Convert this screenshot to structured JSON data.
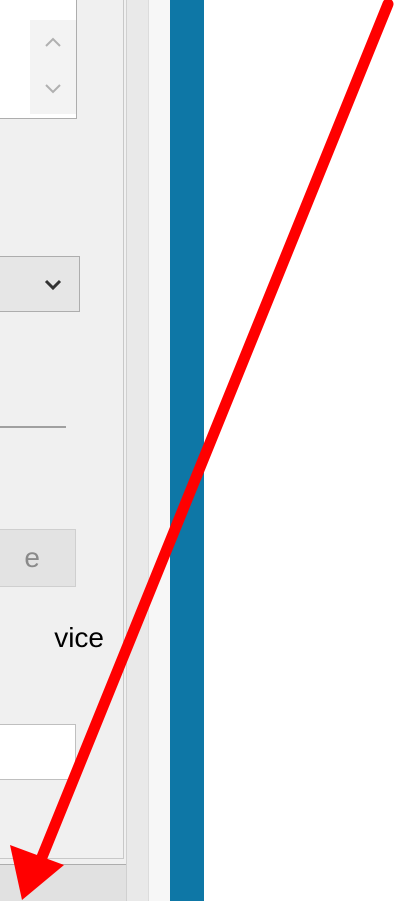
{
  "dialog": {
    "spinner": {
      "up_icon": "chevron-up-icon",
      "down_icon": "chevron-down-icon"
    },
    "dropdown": {
      "icon": "chevron-down-icon"
    },
    "disabled_button_label": "e",
    "partial_label": "vice",
    "text_field_value": ""
  },
  "annotation": {
    "arrow_color": "#ff0000",
    "arrow_icon": "arrow-icon"
  },
  "colors": {
    "accent_bar": "#0e77a6",
    "panel_bg": "#f0f0f0"
  }
}
